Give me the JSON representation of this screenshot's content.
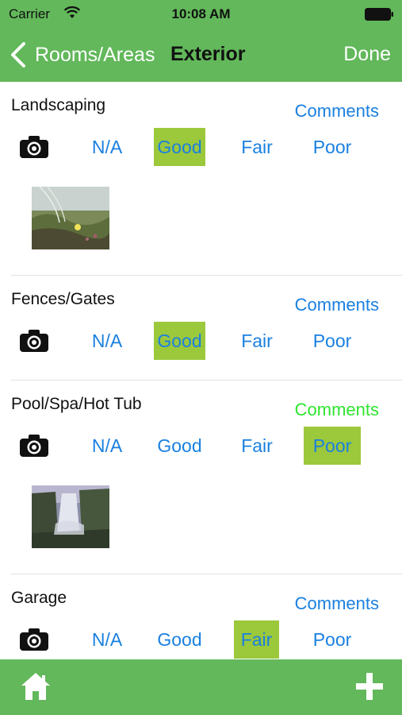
{
  "status_bar": {
    "carrier": "Carrier",
    "time": "10:08 AM",
    "wifi_icon": "wifi-icon",
    "battery_icon": "battery-icon"
  },
  "nav": {
    "back_label": "Rooms/Areas",
    "title": "Exterior",
    "done_label": "Done"
  },
  "sections": [
    {
      "title": "Landscaping",
      "comments_label": "Comments",
      "comments_active": false,
      "ratings": [
        "N/A",
        "Good",
        "Fair",
        "Poor"
      ],
      "selected": "Good",
      "has_photo": true,
      "photo": "landscape-photo"
    },
    {
      "title": "Fences/Gates",
      "comments_label": "Comments",
      "comments_active": false,
      "ratings": [
        "N/A",
        "Good",
        "Fair",
        "Poor"
      ],
      "selected": "Good",
      "has_photo": false
    },
    {
      "title": "Pool/Spa/Hot Tub",
      "comments_label": "Comments",
      "comments_active": true,
      "ratings": [
        "N/A",
        "Good",
        "Fair",
        "Poor"
      ],
      "selected": "Poor",
      "has_photo": true,
      "photo": "waterfall-photo"
    },
    {
      "title": "Garage",
      "comments_label": "Comments",
      "comments_active": false,
      "ratings": [
        "N/A",
        "Good",
        "Fair",
        "Poor"
      ],
      "selected": "Fair",
      "has_photo": false
    }
  ],
  "tab_bar": {
    "left_icon": "home-icon",
    "right_icon": "plus-icon"
  },
  "colors": {
    "bar_green": "#62b85a",
    "selected_rating": "#9cc83c",
    "link_blue": "#1a80e0",
    "comments_active": "#2ee52e"
  }
}
